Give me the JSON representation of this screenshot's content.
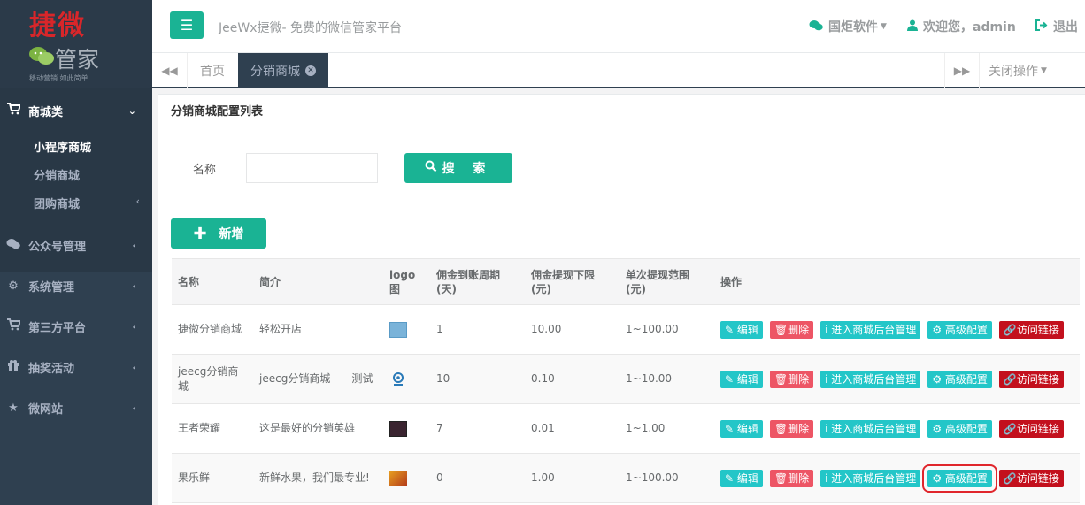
{
  "brand": {
    "logo_main": "捷微",
    "logo_sub": "管家",
    "slogan": "移动营销  如此简单"
  },
  "sidebar": {
    "groups": [
      {
        "label": "商城类",
        "icon": "cart-icon",
        "expanded": true,
        "items": [
          {
            "label": "小程序商城",
            "active": true
          },
          {
            "label": "分销商城"
          },
          {
            "label": "团购商城"
          }
        ]
      },
      {
        "label": "公众号管理",
        "icon": "wechat-icon"
      },
      {
        "label": "系统管理",
        "icon": "gear-icon"
      },
      {
        "label": "第三方平台",
        "icon": "cart-icon"
      },
      {
        "label": "抽奖活动",
        "icon": "gift-icon"
      },
      {
        "label": "微网站",
        "icon": "star-icon"
      }
    ]
  },
  "header": {
    "title": "JeeWx捷微- 免费的微信管家平台",
    "company": "国炬软件",
    "welcome": "欢迎您，admin",
    "logout": "退出"
  },
  "tabs": {
    "home": "首页",
    "active": "分销商城",
    "close_ops": "关闭操作"
  },
  "panel": {
    "title": "分销商城配置列表",
    "search_label": "名称",
    "search_value": "",
    "search_button": "搜 索",
    "add_button": "新增"
  },
  "table": {
    "headers": [
      "名称",
      "简介",
      "logo图",
      "佣金到账周期(天)",
      "佣金提现下限(元)",
      "单次提现范围(元)",
      "操作"
    ],
    "rows": [
      {
        "name": "捷微分销商城",
        "intro": "轻松开店",
        "period": "1",
        "min": "10.00",
        "range": "1~100.00"
      },
      {
        "name": "jeecg分销商城",
        "intro": "jeecg分销商城——测试",
        "period": "10",
        "min": "0.10",
        "range": "1~10.00"
      },
      {
        "name": "王者荣耀",
        "intro": "这是最好的分销英雄",
        "period": "7",
        "min": "0.01",
        "range": "1~1.00"
      },
      {
        "name": "果乐鲜",
        "intro": "新鲜水果，我们最专业!",
        "period": "0",
        "min": "1.00",
        "range": "1~100.00"
      }
    ],
    "actions": {
      "edit": "编辑",
      "delete": "删除",
      "enter": "进入商城后台管理",
      "advanced": "高级配置",
      "link": "访问链接"
    }
  },
  "colors": {
    "sidebar": "#2f4050",
    "primary": "#1ab394",
    "info": "#23c6c8",
    "danger": "#ed5565",
    "dark_red": "#c3101d",
    "highlight": "#e0262c"
  }
}
